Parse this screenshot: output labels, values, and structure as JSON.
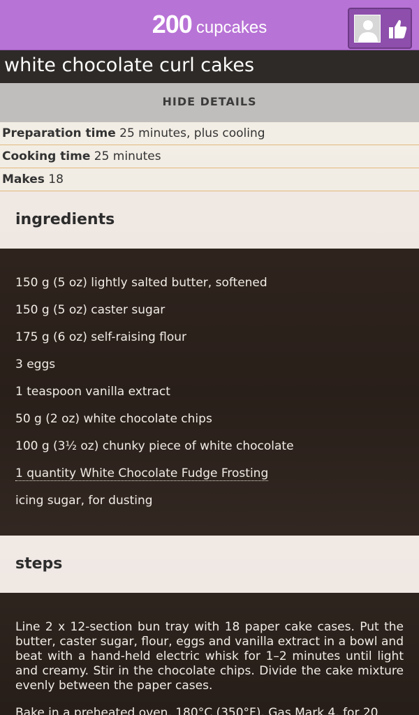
{
  "app": {
    "brand_number": "200",
    "brand_word": "cupcakes"
  },
  "recipe": {
    "title": "white chocolate curl cakes",
    "hide_details_label": "HIDE DETAILS",
    "prep_label": "Preparation time",
    "prep_value": "25 minutes, plus cooling",
    "cook_label": "Cooking time",
    "cook_value": "25 minutes",
    "makes_label": "Makes",
    "makes_value": "18"
  },
  "ingredients": {
    "heading": "ingredients",
    "items": [
      "150 g (5 oz) lightly salted butter, softened",
      "150 g (5 oz) caster sugar",
      "175 g (6 oz) self-raising flour",
      "3 eggs",
      "1 teaspoon vanilla extract",
      "50 g (2 oz) white chocolate chips",
      "100 g (3½ oz) chunky piece of white chocolate",
      "1 quantity White Chocolate Fudge Frosting",
      "icing sugar, for dusting"
    ]
  },
  "steps": {
    "heading": "steps",
    "items": [
      "Line 2 x 12-section bun tray with 18 paper cake cases. Put the butter, caster sugar, flour, eggs and vanilla extract in a bowl and beat with a hand-held electric whisk for 1–2 minutes until light and creamy. Stir in the chocolate chips. Divide the cake mixture evenly between the paper cases.",
      "Bake in a preheated oven, 180°C (350°F), Gas Mark 4, for 20"
    ]
  },
  "icons": {
    "profile": "user-silhouette",
    "like": "thumbs-up"
  },
  "colors": {
    "header_bg": "#b873d6",
    "title_bar": "#2e2a27"
  }
}
